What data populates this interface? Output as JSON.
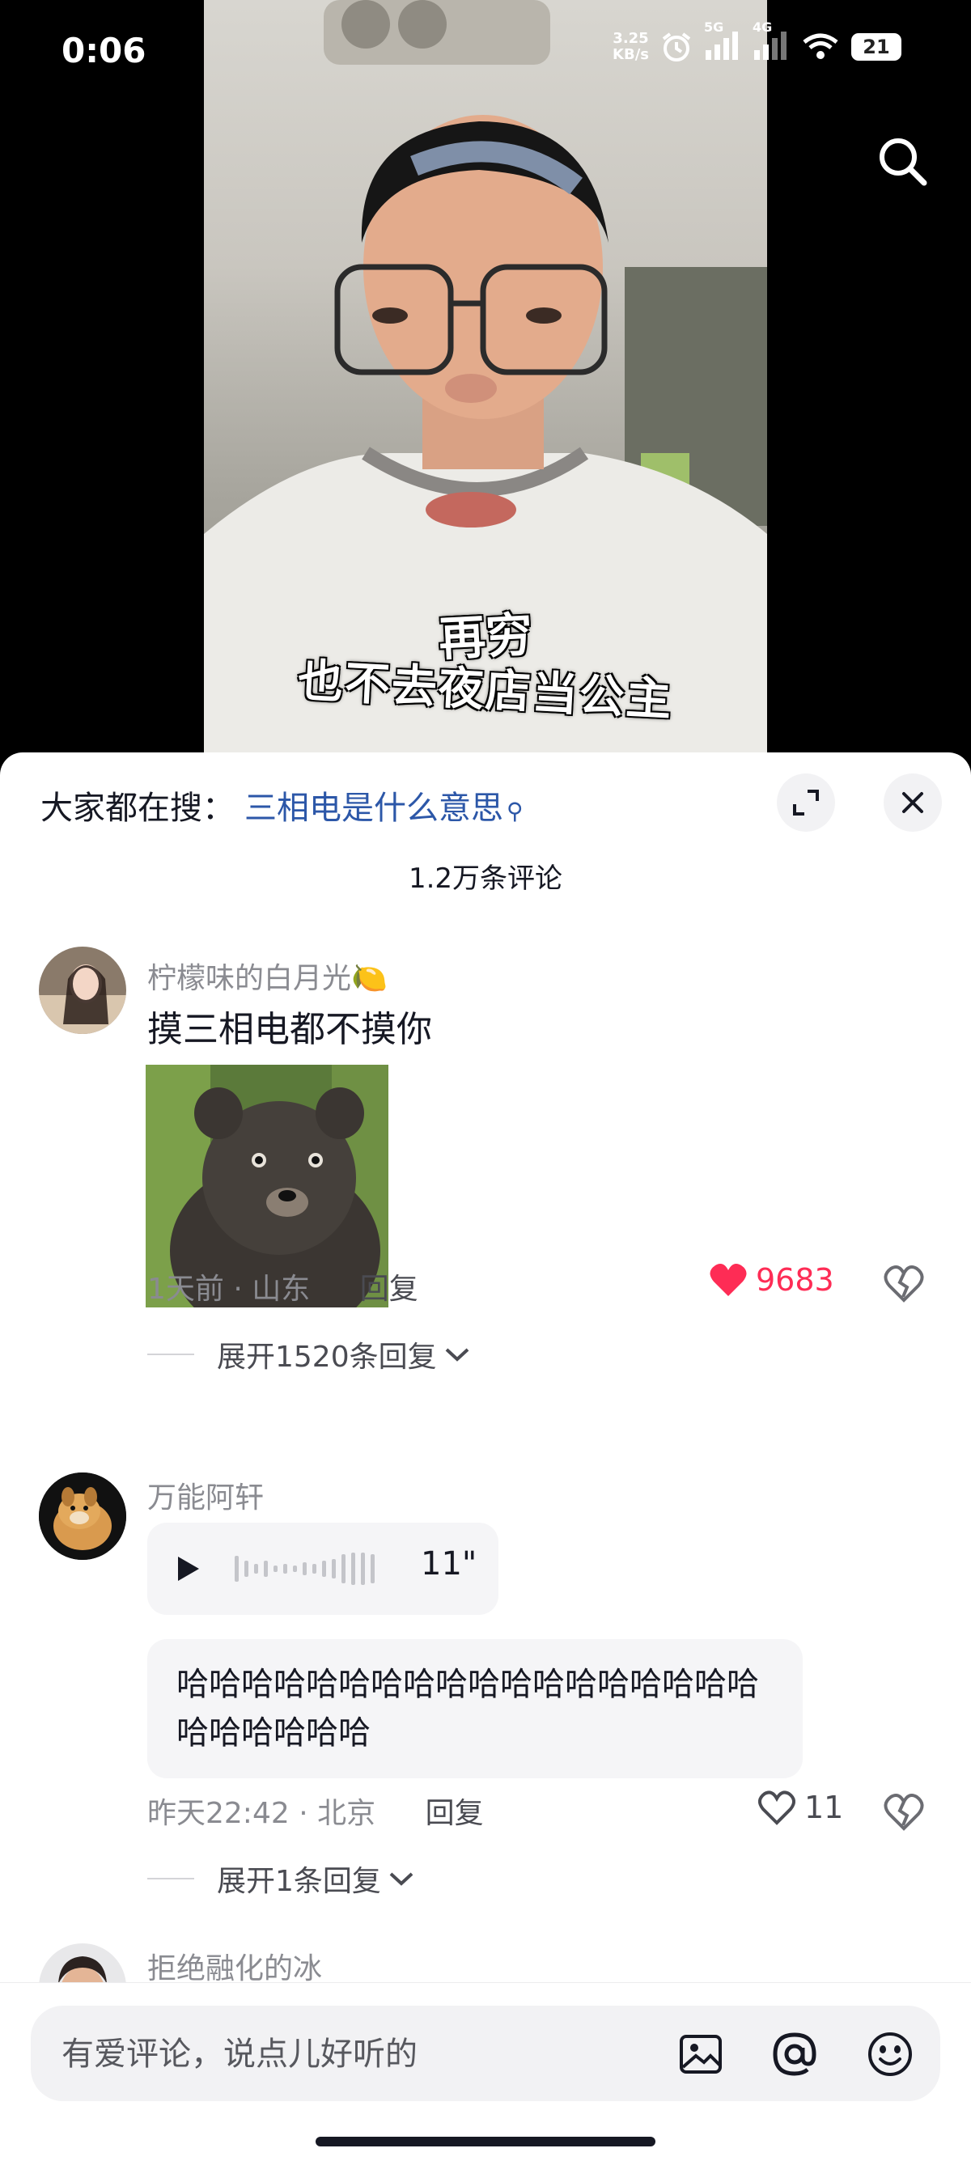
{
  "status_bar": {
    "time": "0:06",
    "net_speed_value": "3.25",
    "net_speed_unit": "KB/s",
    "sig1": "5G",
    "sig2": "4G",
    "battery": "21"
  },
  "video": {
    "caption_line1": "再穷",
    "caption_line2": "也不去夜店当公主"
  },
  "sheet": {
    "hot_search_label": "大家都在搜：",
    "hot_search_query": "三相电是什么意思",
    "comment_count_title": "1.2万条评论"
  },
  "comments": [
    {
      "username": "柠檬味的白月光",
      "emoji": "🍋",
      "text": "摸三相电都不摸你",
      "time": "1天前",
      "location": "山东",
      "reply_label": "回复",
      "likes": "9683",
      "expand_label": "展开1520条回复"
    },
    {
      "username": "万能阿轩",
      "voice_duration": "11\"",
      "text": "哈哈哈哈哈哈哈哈哈哈哈哈哈哈哈哈哈哈哈哈哈哈哈哈",
      "time": "昨天22:42",
      "location": "北京",
      "reply_label": "回复",
      "likes": "11",
      "expand_label": "展开1条回复"
    },
    {
      "username": "拒绝融化的冰"
    }
  ],
  "input": {
    "placeholder": "有爱评论，说点儿好听的"
  },
  "colors": {
    "accent_like": "#fe2c55",
    "link_blue": "#2c57a8",
    "muted_text": "#8a8b91"
  },
  "icons": [
    "search-icon",
    "expand-icon",
    "close-icon",
    "heart-filled-icon",
    "heart-outline-icon",
    "broken-heart-icon",
    "play-icon",
    "waveform-icon",
    "image-icon",
    "at-icon",
    "emoji-icon",
    "chevron-down-icon",
    "alarm-icon",
    "wifi-icon"
  ]
}
